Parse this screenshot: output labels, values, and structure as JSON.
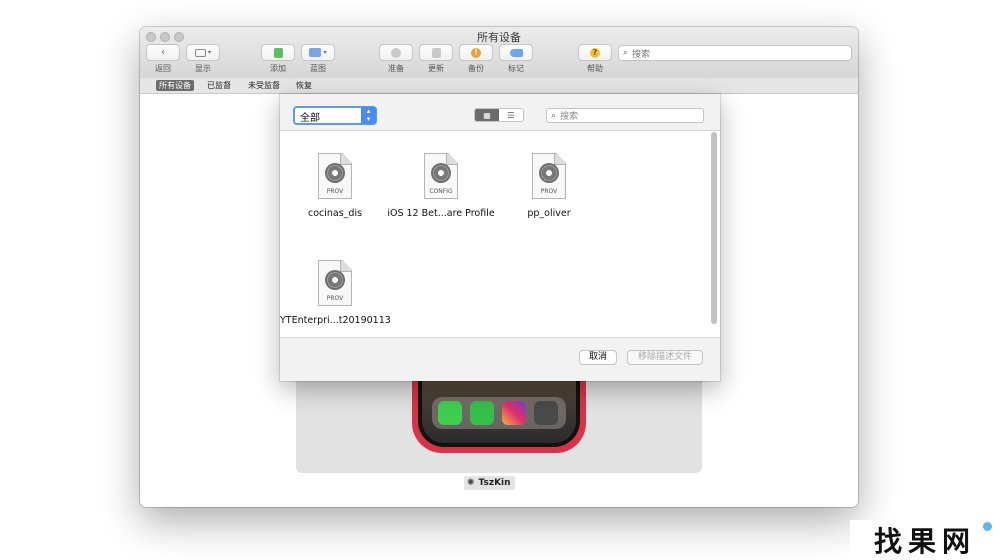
{
  "window": {
    "title": "所有设备"
  },
  "toolbar": {
    "items": [
      {
        "label": "返回",
        "icon": "chevron-left-icon"
      },
      {
        "label": "显示",
        "icon": "view-mode-icon"
      },
      {
        "label": "添加",
        "icon": "add-icon",
        "color": "#5cbe5c"
      },
      {
        "label": "蓝图",
        "icon": "blueprint-icon",
        "color": "#7aa6e6"
      },
      {
        "label": "准备",
        "icon": "prepare-icon"
      },
      {
        "label": "更新",
        "icon": "update-icon"
      },
      {
        "label": "备份",
        "icon": "backup-icon",
        "color": "#f0a030"
      },
      {
        "label": "标记",
        "icon": "tag-icon",
        "color": "#6ba7f0"
      },
      {
        "label": "帮助",
        "icon": "help-icon",
        "color": "#f2c037"
      }
    ],
    "search_placeholder": "搜索"
  },
  "tabs": [
    "所有设备",
    "已监督",
    "未受监督",
    "恢复"
  ],
  "device": {
    "name": "TszKin"
  },
  "dialog": {
    "filter_value": "全部",
    "search_placeholder": "搜索",
    "files": [
      {
        "name": "cocinas_dis",
        "tag": "PROV"
      },
      {
        "name": "iOS 12 Bet...are Profile",
        "tag": "CONFIG"
      },
      {
        "name": "pp_oliver",
        "tag": "PROV"
      },
      {
        "name": "YTEnterpri...t20190113",
        "tag": "PROV"
      }
    ],
    "cancel_label": "取消",
    "remove_label": "移除描述文件"
  },
  "watermark": {
    "text": "找果网"
  },
  "colors": {
    "accent": "#4a8df0",
    "phone": "#d83348"
  }
}
